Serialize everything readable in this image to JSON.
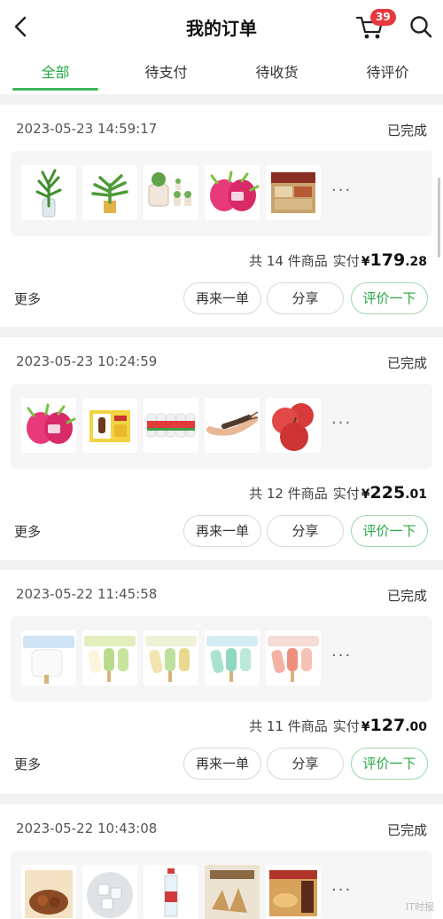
{
  "header": {
    "title": "我的订单",
    "cart_badge": "39"
  },
  "tabs": [
    {
      "label": "全部",
      "active": true
    },
    {
      "label": "待支付",
      "active": false
    },
    {
      "label": "待收货",
      "active": false
    },
    {
      "label": "待评价",
      "active": false
    }
  ],
  "labels": {
    "more": "更多",
    "rebuy": "再来一单",
    "share": "分享",
    "review": "评价一下",
    "paid": "实付",
    "currency": "¥",
    "ellipsis": "···"
  },
  "orders": [
    {
      "datetime": "2023-05-23 14:59:17",
      "status": "已完成",
      "count_text": "共 14 件商品",
      "amount_int": "179",
      "amount_dec": ".28",
      "items": [
        "lucky-bamboo",
        "potted-plant",
        "succulent-set",
        "dragon-fruit",
        "snack-box"
      ]
    },
    {
      "datetime": "2023-05-23 10:24:59",
      "status": "已完成",
      "count_text": "共 12 件商品",
      "amount_int": "225",
      "amount_dec": ".01",
      "items": [
        "dragon-fruit",
        "ice-cream-box",
        "yogurt-drinks",
        "shrimp",
        "apples"
      ]
    },
    {
      "datetime": "2023-05-22 11:45:58",
      "status": "已完成",
      "count_text": "共 11 件商品",
      "amount_int": "127",
      "amount_dec": ".00",
      "items": [
        "ice-cream-bar-white",
        "ice-cream-bar-green",
        "ice-cream-bar-yellow",
        "ice-cream-bar-mint",
        "ice-cream-bar-pink"
      ]
    },
    {
      "datetime": "2023-05-22 10:43:08",
      "status": "已完成",
      "items": [
        "braised-meat",
        "ice-cubes",
        "water-bottle",
        "dried-snack",
        "cake-box"
      ]
    }
  ],
  "watermark": "IT时报"
}
